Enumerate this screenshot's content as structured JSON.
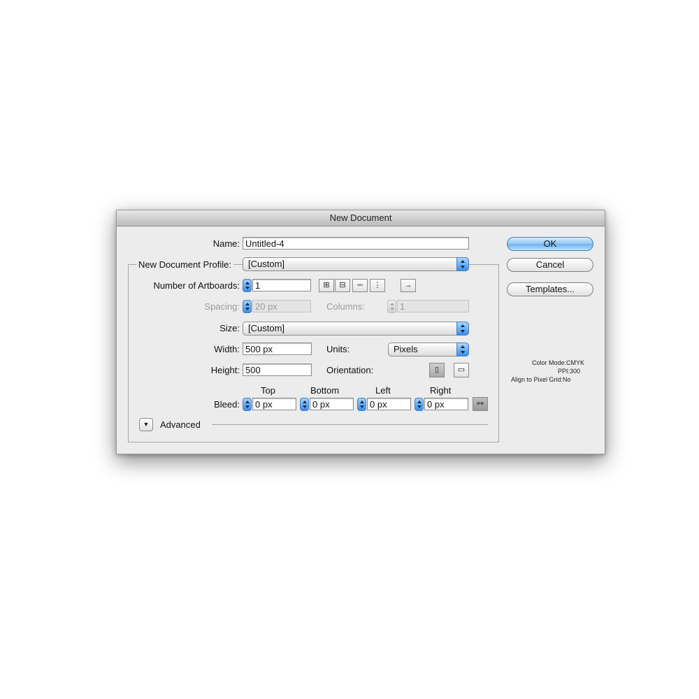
{
  "dialog": {
    "title": "New Document"
  },
  "name": {
    "label": "Name:",
    "value": "Untitled-4"
  },
  "profile": {
    "label": "New Document Profile:",
    "value": "[Custom]"
  },
  "artboards": {
    "label": "Number of Artboards:",
    "value": "1",
    "layout_icons": [
      "grid-by-row-icon",
      "grid-by-column-icon",
      "arrange-by-row-icon",
      "arrange-by-column-icon"
    ],
    "direction_icon": "right-arrow-icon"
  },
  "spacing": {
    "label": "Spacing:",
    "value": "20 px"
  },
  "columns": {
    "label": "Columns:",
    "value": "1"
  },
  "size": {
    "label": "Size:",
    "value": "[Custom]"
  },
  "width": {
    "label": "Width:",
    "value": "500 px"
  },
  "units": {
    "label": "Units:",
    "value": "Pixels"
  },
  "height": {
    "label": "Height:",
    "value": "500"
  },
  "orientation": {
    "label": "Orientation:",
    "icons": [
      "portrait-icon",
      "landscape-icon"
    ]
  },
  "bleed": {
    "label": "Bleed:",
    "top": {
      "label": "Top",
      "value": "0 px"
    },
    "bottom": {
      "label": "Bottom",
      "value": "0 px"
    },
    "left": {
      "label": "Left",
      "value": "0 px"
    },
    "right": {
      "label": "Right",
      "value": "0 px"
    },
    "link_icon": "chain-link-icon"
  },
  "advanced": {
    "label": "Advanced"
  },
  "buttons": {
    "ok": "OK",
    "cancel": "Cancel",
    "templates": "Templates..."
  },
  "info": {
    "color_mode_label": "Color Mode:",
    "color_mode_value": "CMYK",
    "ppi_label": "PPI:",
    "ppi_value": "300",
    "align_label": "Align to Pixel Grid:",
    "align_value": "No"
  },
  "colors": {
    "accent": "#3a8ee8",
    "dialog_bg": "#ececec"
  }
}
